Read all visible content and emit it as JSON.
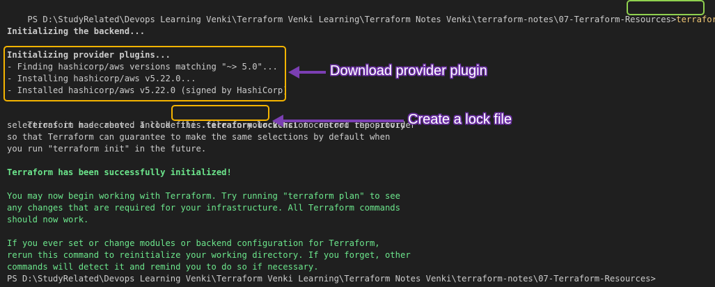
{
  "terminal": {
    "prompt_top": "PS D:\\StudyRelated\\Devops Learning Venki\\Terraform Venki Learning\\Terraform Notes Venki\\terraform-notes\\07-Terraform-Resources>",
    "command": "terraform init",
    "backend_line": "Initializing the backend...",
    "provider_block": {
      "heading": "Initializing provider plugins...",
      "lines": [
        "- Finding hashicorp/aws versions matching \"~> 5.0\"...",
        "- Installing hashicorp/aws v5.22.0...",
        "- Installed hashicorp/aws v5.22.0 (signed by HashiCorp)"
      ]
    },
    "lock_para": {
      "line1_pre": "Terraform has created a lock file ",
      "lock_filename": ".terraform.lock.hcl",
      "line1_post": " to record the provider",
      "line2": "selections it made above. Include this file in your version control repository",
      "line3": "so that Terraform can guarantee to make the same selections by default when",
      "line4": "you run \"terraform init\" in the future."
    },
    "success": "Terraform has been successfully initialized!",
    "next_para": [
      "You may now begin working with Terraform. Try running \"terraform plan\" to see",
      "any changes that are required for your infrastructure. All Terraform commands",
      "should now work."
    ],
    "modules_para": [
      "If you ever set or change modules or backend configuration for Terraform,",
      "rerun this command to reinitialize your working directory. If you forget, other",
      "commands will detect it and remind you to do so if necessary."
    ],
    "prompt_bottom": "PS D:\\StudyRelated\\Devops Learning Venki\\Terraform Venki Learning\\Terraform Notes Venki\\terraform-notes\\07-Terraform-Resources>"
  },
  "annotations": {
    "download": "Download provider plugin",
    "lock": "Create a lock file"
  },
  "colors": {
    "background": "#1f1f1f",
    "text": "#cccccc",
    "success_green": "#23d18b",
    "box_green": "#8fd14f",
    "box_yellow": "#f5b400",
    "arrow_purple": "#7b3fb3"
  }
}
